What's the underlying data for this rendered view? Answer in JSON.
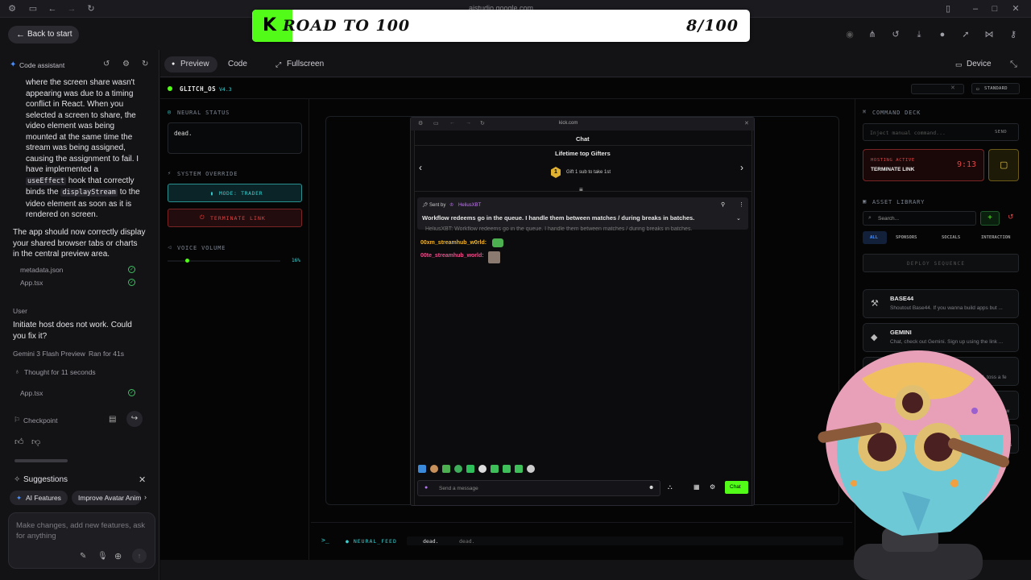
{
  "os": {
    "url": "aistudio.google.com"
  },
  "banner": {
    "k": "K",
    "title": "ROAD TO 100",
    "count": "8/100"
  },
  "topbar": {
    "back_label": "Back to start"
  },
  "left": {
    "header": "Code assistant",
    "message_p1": "where the screen share wasn't appearing was due to a timing conflict in React. When you selected a screen to share, the video element was being mounted at the same time the stream was being assigned, causing the assignment to fail. I have implemented a",
    "code1": "useEffect",
    "message_p2": "hook that correctly binds the",
    "code2": "displayStream",
    "message_p3": "to the video element as soon as it is rendered on screen.",
    "message2": "The app should now correctly display your shared browser tabs or charts in the central preview area.",
    "files1": [
      "metadata.json",
      "App.tsx"
    ],
    "user_label": "User",
    "user_msg": "Initiate host does not work. Could you fix it?",
    "model": "Gemini 3 Flash Preview",
    "ran_for": "Ran for 41s",
    "thought": "Thought for 11 seconds",
    "files2": [
      "App.tsx"
    ],
    "checkpoint": "Checkpoint",
    "suggestions": "Suggestions",
    "chips": [
      "AI Features",
      "Improve Avatar Anim"
    ],
    "input_placeholder": "Make changes, add new features, ask for anything"
  },
  "preview_toolbar": {
    "preview": "Preview",
    "code": "Code",
    "fullscreen": "Fullscreen",
    "device": "Device"
  },
  "app": {
    "logo": "GLITCH_OS",
    "version": "V4.3",
    "mode_badge": "STANDARD",
    "neural_status_label": "NEURAL STATUS",
    "neural_status_value": "dead.",
    "system_override_label": "SYSTEM OVERRIDE",
    "mode_button": "MODE: TRADER",
    "terminate_button": "TERMINATE LINK",
    "voice_volume_label": "VOICE VOLUME",
    "voice_volume_value": "16%",
    "voice_volume_level": 0.16,
    "feed_label": "NEURAL_FEED",
    "feed_text1": "dead.",
    "feed_text2": "dead.",
    "command_deck_label": "COMMAND DECK",
    "command_placeholder": "Inject manual command...",
    "send_label": "SEND",
    "hosting_label": "HOSTING ACTIVE",
    "hosting_action": "TERMINATE LINK",
    "hosting_timer": "9:13",
    "asset_library_label": "ASSET LIBRARY",
    "search_placeholder": "Search...",
    "tabs": [
      "ALL",
      "SPONSORS",
      "SOCIALS",
      "INTERACTION"
    ],
    "deploy_label": "DEPLOY SEQUENCE",
    "assets": [
      {
        "title": "BASE44",
        "desc": "Shoutout Base44. If you wanna build apps but ..."
      },
      {
        "title": "GEMINI",
        "desc": "Chat, check out Gemini. Sign up using the link ..."
      }
    ],
    "asset_fragments": [
      "ound, toss a fe",
      "/ww",
      "ngers"
    ]
  },
  "kick": {
    "url": "kick.com",
    "title": "Chat",
    "gifters_title": "Lifetime top Gifters",
    "gift_rank": "1",
    "gift_text": "Gift 1 sub to take 1st",
    "pinned_sent_by": "Sent by",
    "pinned_user": "HeliusXBT",
    "pinned_msg": "Workflow redeems go in the queue. I handle them between matches / during breaks in batches.",
    "ghost_msg": "HeliusXBT: Workflow redeems go in the queue. I handle them between matches / during breaks in batches.",
    "user1": "00xm_streamhub_w0rld:",
    "user2": "00te_streamhub_world:",
    "send_placeholder": "Send a message",
    "chat_button": "Chat"
  },
  "colors": {
    "accent_green": "#53fc18",
    "cyan": "#3ad0d0",
    "red": "#e04545"
  }
}
